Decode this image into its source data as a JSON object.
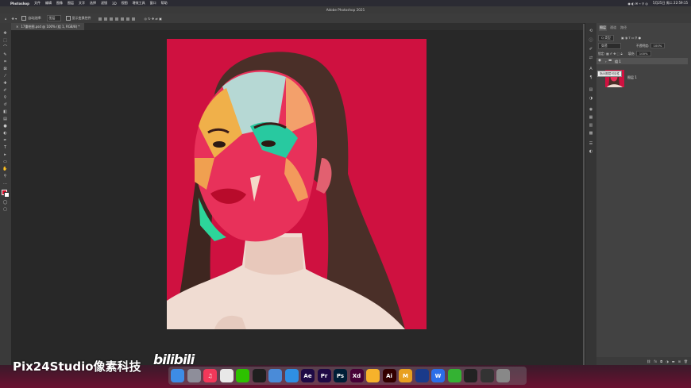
{
  "menubar": {
    "apple_glyph": "",
    "app_name": "Photoshop",
    "items": [
      "文件",
      "编辑",
      "图像",
      "图层",
      "文字",
      "选择",
      "滤镜",
      "3D",
      "视图",
      "增效工具",
      "窗口",
      "帮助"
    ],
    "right": {
      "datetime": "5月25日 周二  22:59:15"
    }
  },
  "window": {
    "title": "Adobe Photoshop 2021"
  },
  "options_bar": {
    "auto_select_label": "自动选择:",
    "auto_select_value": "图层",
    "show_transform_label": "显示变换控件"
  },
  "document": {
    "tab_label": "17重绘图.psd @ 100% (组 1, RGB/8) *"
  },
  "layers_panel": {
    "tabs": [
      "图层",
      "通道",
      "路径"
    ],
    "filter_label": "Q 类型",
    "blend_mode": "穿透",
    "opacity_label": "不透明度:",
    "opacity_value": "100%",
    "lock_label": "锁定:",
    "fill_label": "填充:",
    "fill_value": "100%",
    "group_name": "组 1",
    "layer_name": "图层 1",
    "tooltip": "指示图层可见性"
  },
  "watermark": {
    "text": "Pix24Studio像素科技",
    "logo": "bilibili"
  },
  "dock": {
    "apps": [
      {
        "name": "finder",
        "label": "",
        "color": "#3d8ce6"
      },
      {
        "name": "launchpad",
        "label": "",
        "color": "#8e8e9a"
      },
      {
        "name": "music",
        "label": "♫",
        "color": "#f2385a"
      },
      {
        "name": "chrome",
        "label": "",
        "color": "#e8e8e8"
      },
      {
        "name": "wechat",
        "label": "",
        "color": "#2dc100"
      },
      {
        "name": "qq",
        "label": "",
        "color": "#1f1f1f"
      },
      {
        "name": "unknown-app",
        "label": "",
        "color": "#4a8bd8"
      },
      {
        "name": "safari",
        "label": "",
        "color": "#2f8fe3"
      },
      {
        "name": "after-effects",
        "label": "Ae",
        "color": "#1f0a45"
      },
      {
        "name": "premiere",
        "label": "Pr",
        "color": "#1f0a45"
      },
      {
        "name": "photoshop",
        "label": "Ps",
        "color": "#001e36"
      },
      {
        "name": "xd",
        "label": "Xd",
        "color": "#470137"
      },
      {
        "name": "sketch",
        "label": "",
        "color": "#f6b22b"
      },
      {
        "name": "illustrator",
        "label": "Ai",
        "color": "#330000"
      },
      {
        "name": "m-app",
        "label": "M",
        "color": "#e8a020"
      },
      {
        "name": "c4d",
        "label": "",
        "color": "#1a3a8a"
      },
      {
        "name": "wps",
        "label": "W",
        "color": "#2b6ee8"
      },
      {
        "name": "camtasia",
        "label": "",
        "color": "#34b233"
      },
      {
        "name": "penguin",
        "label": "",
        "color": "#222"
      },
      {
        "name": "activity",
        "label": "",
        "color": "#333"
      },
      {
        "name": "trash",
        "label": "",
        "color": "#888"
      }
    ]
  }
}
